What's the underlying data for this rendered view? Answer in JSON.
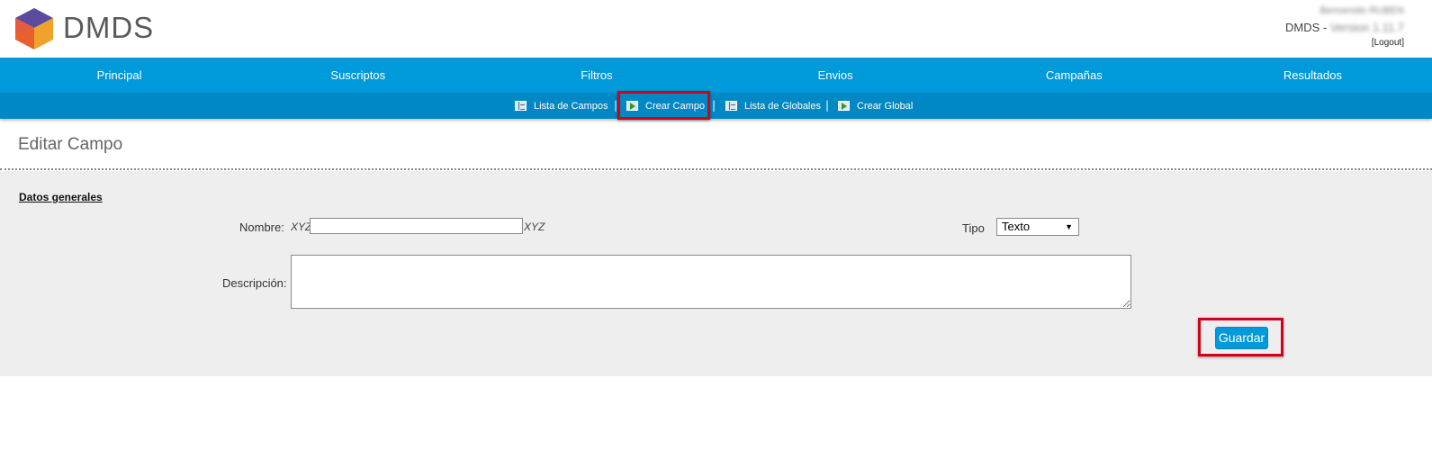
{
  "brand": {
    "name": "DMDS",
    "colors": {
      "cube_top": "#5b4a9e",
      "cube_left": "#e8612c",
      "cube_right": "#f0a32b",
      "nav": "#009ada",
      "subnav": "#0088c4",
      "highlight": "#d0021b"
    }
  },
  "header": {
    "user_name": "Benvenido RUBEN",
    "version_prefix": "DMDS - ",
    "version_value": "Version 1.11.7",
    "logout_label": "[Logout]"
  },
  "main_nav": [
    "Principal",
    "Suscriptos",
    "Filtros",
    "Envios",
    "Campañas",
    "Resultados"
  ],
  "sub_nav": {
    "items": [
      {
        "label": "Lista de Campos",
        "icon": "list-icon"
      },
      {
        "label": "Crear Campo",
        "icon": "create-icon",
        "active": true
      },
      {
        "label": "Lista de Globales",
        "icon": "list-icon"
      },
      {
        "label": "Crear Global",
        "icon": "create-icon"
      }
    ],
    "separator": "|"
  },
  "page": {
    "title": "Editar Campo"
  },
  "form": {
    "section_title": "Datos generales",
    "nombre": {
      "label": "Nombre:",
      "prefix": "XYZ",
      "suffix": "XYZ",
      "value": ""
    },
    "tipo": {
      "label": "Tipo",
      "selected": "Texto"
    },
    "descripcion": {
      "label": "Descripción:",
      "value": ""
    },
    "save_label": "Guardar"
  }
}
